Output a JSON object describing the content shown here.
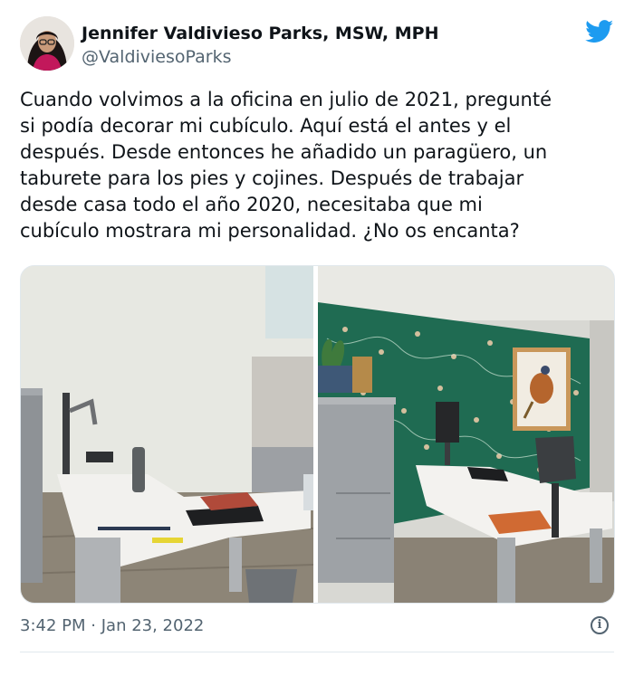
{
  "author": {
    "name": "Jennifer Valdivieso Parks, MSW, MPH",
    "handle": "@ValdiviesoParks"
  },
  "tweet": {
    "text": "Cuando volvimos a la oficina en julio de 2021, pregunté\nsi podía decorar mi cubículo. Aquí está el antes y el\ndespués. Desde entonces he añadido un paragüero, un\ntaburete para los pies y cojines. Después de trabajar\ndesde casa todo el año 2020, necesitaba que mi\ncubículo mostrara mi personalidad. ¿No os encanta?"
  },
  "timestamp": {
    "time": "3:42 PM",
    "separator": "·",
    "date": "Jan 23, 2022"
  },
  "icons": {
    "brand": "twitter-bird-icon",
    "info": "info-icon"
  },
  "colors": {
    "brand": "#1d9bf0",
    "muted": "#536471",
    "wallpaper": "#1f6b52"
  }
}
